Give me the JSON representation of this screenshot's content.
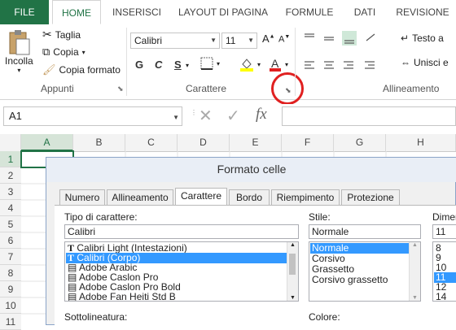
{
  "ribbon_tabs": [
    "FILE",
    "HOME",
    "INSERISCI",
    "LAYOUT DI PAGINA",
    "FORMULE",
    "DATI",
    "REVISIONE"
  ],
  "clipboard": {
    "paste": "Incolla",
    "cut": "Taglia",
    "copy": "Copia",
    "format_painter": "Copia formato",
    "group": "Appunti"
  },
  "font": {
    "name": "Calibri",
    "size": "11",
    "bold": "G",
    "italic": "C",
    "underline": "S",
    "group": "Carattere"
  },
  "alignment": {
    "wrap": "Testo a",
    "merge": "Unisci e",
    "group": "Allineamento"
  },
  "formula_bar": {
    "name_box": "A1",
    "fx": "fx"
  },
  "sheet": {
    "columns": [
      "A",
      "B",
      "C",
      "D",
      "E",
      "F",
      "G",
      "H"
    ],
    "rows": [
      "1",
      "2",
      "3",
      "4",
      "5",
      "6",
      "7",
      "8",
      "9",
      "10",
      "11"
    ]
  },
  "dialog": {
    "title": "Formato celle",
    "tabs": [
      "Numero",
      "Allineamento",
      "Carattere",
      "Bordo",
      "Riempimento",
      "Protezione"
    ],
    "font_label": "Tipo di carattere:",
    "font_value": "Calibri",
    "font_list": [
      "Calibri Light (Intestazioni)",
      "Calibri (Corpo)",
      "Adobe Arabic",
      "Adobe Caslon Pro",
      "Adobe Caslon Pro Bold",
      "Adobe Fan Heiti Std B"
    ],
    "style_label": "Stile:",
    "style_value": "Normale",
    "style_list": [
      "Normale",
      "Corsivo",
      "Grassetto",
      "Corsivo grassetto"
    ],
    "size_label": "Dimer",
    "size_value": "11",
    "size_list": [
      "8",
      "9",
      "10",
      "11",
      "12",
      "14"
    ],
    "underline_label": "Sottolineatura:",
    "color_label": "Colore:"
  },
  "colors": {
    "accent": "#217346",
    "highlight": "#3399ff",
    "callout": "#e02020"
  }
}
